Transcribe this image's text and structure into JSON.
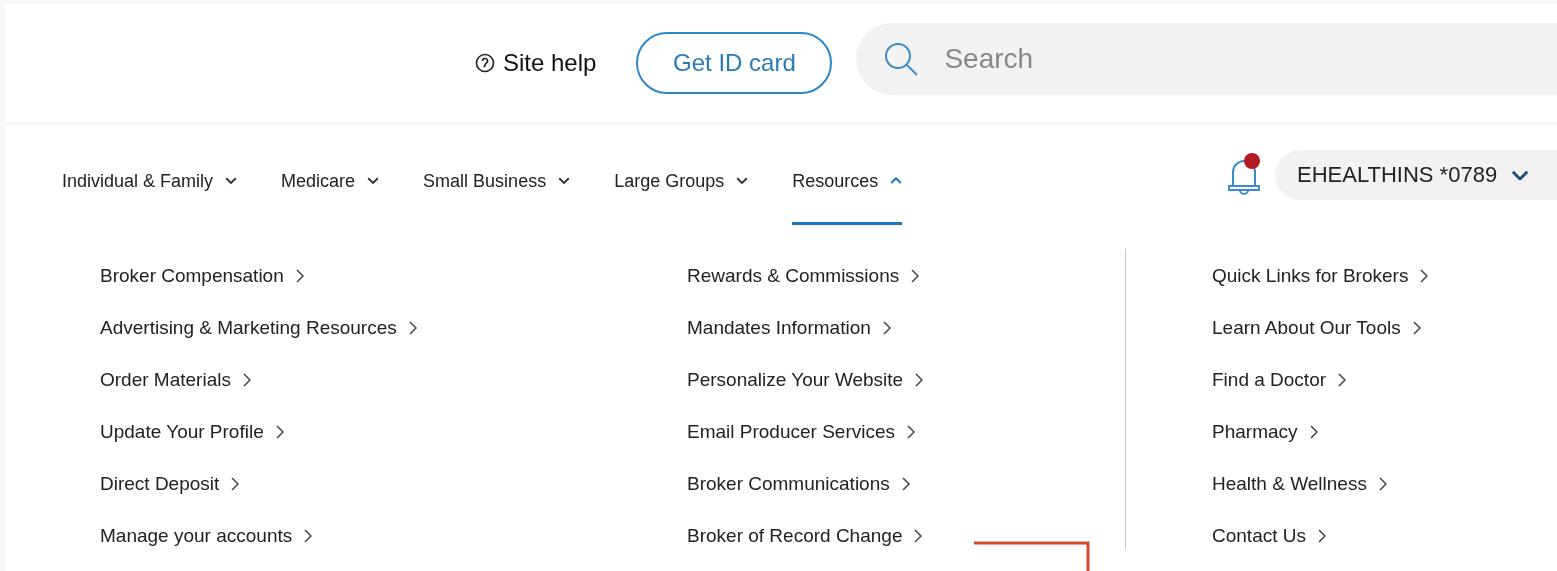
{
  "header": {
    "site_help": "Site help",
    "id_card_button": "Get ID card",
    "search": {
      "placeholder": "Search"
    }
  },
  "nav": [
    {
      "label": "Individual & Family",
      "selected": false
    },
    {
      "label": "Medicare",
      "selected": false
    },
    {
      "label": "Small Business",
      "selected": false
    },
    {
      "label": "Large Groups",
      "selected": false
    },
    {
      "label": "Resources",
      "selected": true
    }
  ],
  "notifications": {
    "unread": true
  },
  "account": "EHEALTHINS *0789",
  "menu_columns": [
    [
      "Broker Compensation",
      "Advertising & Marketing Resources",
      "Order Materials",
      "Update Your Profile",
      "Direct Deposit",
      "Manage your accounts"
    ],
    [
      "Rewards & Commissions",
      "Mandates Information",
      "Personalize Your Website",
      "Email Producer Services",
      "Broker Communications",
      "Broker of Record Change"
    ],
    [
      "Quick Links for Brokers",
      "Learn About Our Tools",
      "Find a Doctor",
      "Pharmacy",
      "Health & Wellness",
      "Contact Us"
    ]
  ]
}
